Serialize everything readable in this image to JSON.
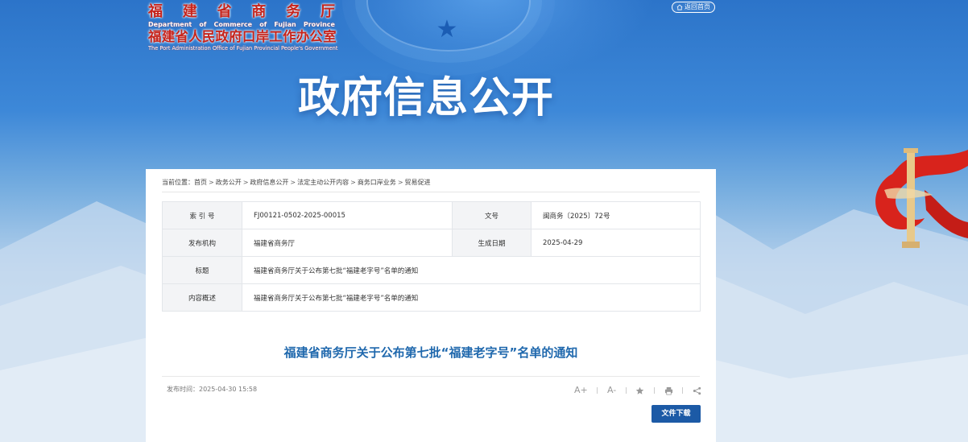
{
  "header": {
    "logo_cn_line1": [
      "福",
      "建",
      "省",
      "商",
      "务",
      "厅"
    ],
    "logo_en_line1": [
      "Department",
      "of",
      "Commerce",
      "of",
      "Fujian",
      "Province"
    ],
    "logo_cn_line2": "福建省人民政府口岸工作办公室",
    "logo_en_line2": "The Port Administration Office of Fujian Provincial People's Government",
    "home_label": "返回首页",
    "banner_title": "政府信息公开"
  },
  "breadcrumb": {
    "prefix": "当前位置：",
    "items": [
      "首页",
      "政务公开",
      "政府信息公开",
      "法定主动公开内容",
      "商务口岸业务",
      "贸易促进"
    ],
    "separator": ">"
  },
  "meta": {
    "index_label": "索 引 号",
    "index_value": "FJ00121-0502-2025-00015",
    "docno_label": "文号",
    "docno_value": "闽商务〔2025〕72号",
    "issuer_label": "发布机构",
    "issuer_value": "福建省商务厅",
    "date_label": "生成日期",
    "date_value": "2025-04-29",
    "title_label": "标题",
    "title_value": "福建省商务厅关于公布第七批“福建老字号”名单的通知",
    "summary_label": "内容概述",
    "summary_value": "福建省商务厅关于公布第七批“福建老字号”名单的通知"
  },
  "article": {
    "title": "福建省商务厅关于公布第七批“福建老字号”名单的通知",
    "publish_time": "发布时间：2025-04-30 15:58",
    "font_larger": "A+",
    "font_smaller": "A-",
    "download_label": "文件下载"
  },
  "icons": [
    "home-icon",
    "star-icon",
    "print-icon",
    "share-icon"
  ],
  "colors": {
    "title_blue": "#1f68ad",
    "button_blue": "#1c5aa6",
    "logo_red": "#c6241c"
  }
}
